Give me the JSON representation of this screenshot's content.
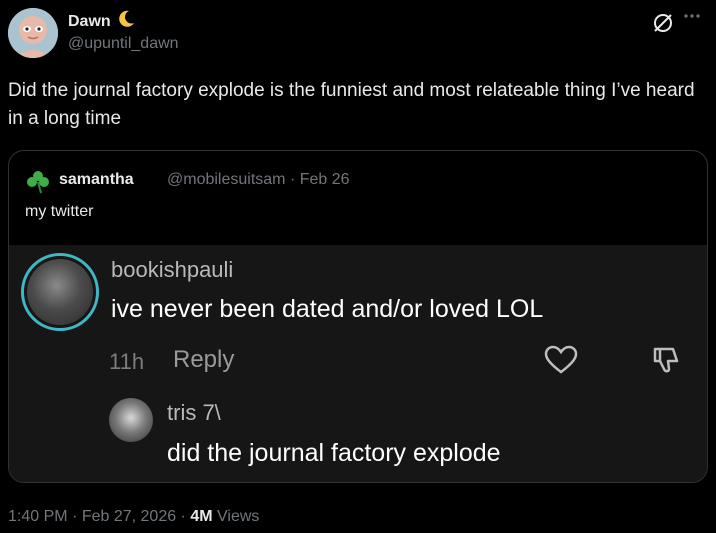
{
  "post": {
    "author": {
      "name": "Dawn",
      "handle": "@upuntil_dawn",
      "name_emoji_icon": "crescent-moon-icon"
    },
    "text": "Did the journal factory explode is the funniest and most relateable thing I’ve heard in a long time",
    "meta": {
      "time": "1:40 PM",
      "date": "Feb 27, 2026",
      "views_count": "4M",
      "views_label": "Views"
    }
  },
  "quoted_post": {
    "author_icon": "shamrock-icon",
    "name": "samantha",
    "handle": "@mobilesuitsam",
    "date": "Feb 26",
    "text": "my twitter",
    "image": {
      "comment": {
        "username": "bookishpauli",
        "text": "ive never been dated and/or loved LOL",
        "time": "11h",
        "reply_label": "Reply"
      },
      "reply": {
        "username": "tris 7\\",
        "text": "did the journal factory explode"
      }
    }
  },
  "colors": {
    "background": "#000000",
    "text_primary": "#e7e9ea",
    "text_secondary": "#71767b",
    "border": "#2f3336",
    "avatar_ring": "#3fb8c4"
  }
}
